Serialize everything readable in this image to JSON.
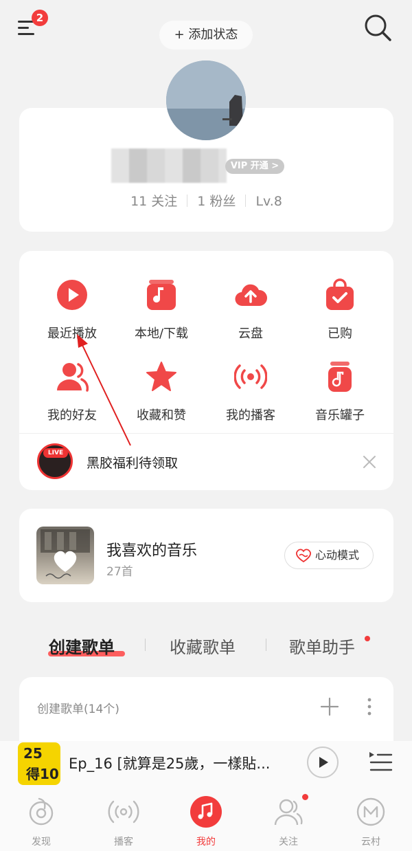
{
  "header": {
    "menu_badge": "2",
    "status_label": "+ 添加状态"
  },
  "profile": {
    "vip_label": "VIP 开通 >",
    "stats": {
      "follow": "11 关注",
      "fans": "1 粉丝",
      "level": "Lv.8"
    }
  },
  "grid": {
    "items": [
      {
        "label": "最近播放",
        "icon": "play-circle-icon"
      },
      {
        "label": "本地/下载",
        "icon": "music-folder-icon"
      },
      {
        "label": "云盘",
        "icon": "cloud-upload-icon"
      },
      {
        "label": "已购",
        "icon": "shopping-bag-icon"
      },
      {
        "label": "我的好友",
        "icon": "friends-icon"
      },
      {
        "label": "收藏和赞",
        "icon": "star-icon"
      },
      {
        "label": "我的播客",
        "icon": "broadcast-icon"
      },
      {
        "label": "音乐罐子",
        "icon": "music-jar-icon"
      }
    ],
    "live_badge": "LIVE",
    "live_text": "黑胶福利待领取"
  },
  "favorite": {
    "title": "我喜欢的音乐",
    "count": "27首",
    "heart_mode": "心动模式"
  },
  "tabs": [
    {
      "label": "创建歌单",
      "active": true
    },
    {
      "label": "收藏歌单",
      "active": false
    },
    {
      "label": "歌单助手",
      "active": false
    }
  ],
  "playlists": {
    "header": "创建歌单(14个)"
  },
  "player": {
    "title": "Ep_16 [就算是25歲，一樣貼...",
    "cover_text_top": "25",
    "cover_text_bottom": "得10"
  },
  "nav": [
    {
      "label": "发现",
      "icon": "discover-icon",
      "active": false
    },
    {
      "label": "播客",
      "icon": "podcast-icon",
      "active": false
    },
    {
      "label": "我的",
      "icon": "music-note-icon",
      "active": true
    },
    {
      "label": "关注",
      "icon": "follow-icon",
      "active": false
    },
    {
      "label": "云村",
      "icon": "village-icon",
      "active": false
    }
  ],
  "colors": {
    "accent": "#f23c3c",
    "background": "#f2f2f2"
  }
}
